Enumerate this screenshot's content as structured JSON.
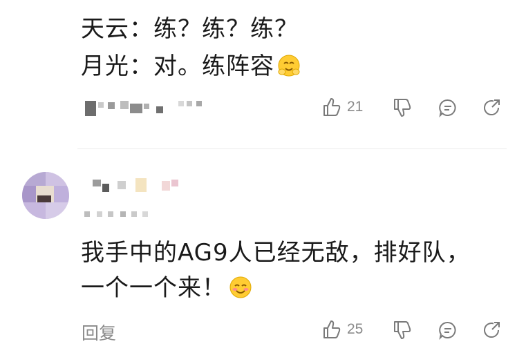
{
  "comment1": {
    "line1": "天云：练？练？练？",
    "line2": "月光：对。练阵容",
    "line2_emoji": "smiling-hands-emoji",
    "actions": {
      "like_count": "21",
      "like_icon": "thumbs-up-icon",
      "dislike_icon": "thumbs-down-icon",
      "comment_icon": "comment-icon",
      "share_icon": "share-icon"
    }
  },
  "comment2": {
    "line1": "我手中的AG9人已经无敌，排好队，",
    "line2": "一个一个来！",
    "line2_emoji": "blushing-smile-emoji",
    "reply_label": "回复",
    "actions": {
      "like_count": "25",
      "like_icon": "thumbs-up-icon",
      "dislike_icon": "thumbs-down-icon",
      "comment_icon": "comment-icon",
      "share_icon": "share-icon"
    }
  },
  "colors": {
    "text": "#1a1a1a",
    "muted": "#8a8a8a",
    "emoji_yellow": "#ffcc33"
  }
}
